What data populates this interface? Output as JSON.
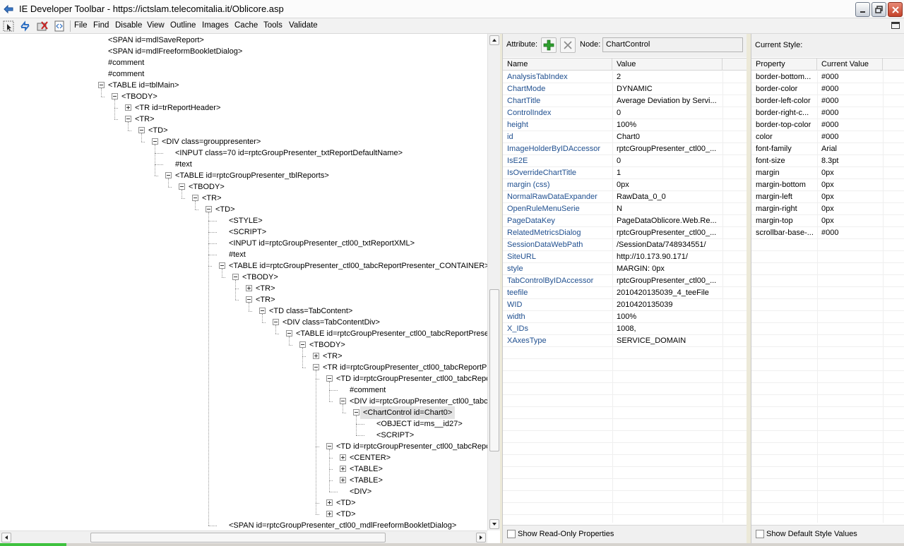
{
  "window": {
    "title": "IE Developer Toolbar - https://ictslam.telecomitalia.it/Oblicore.asp"
  },
  "menu": {
    "items": [
      "File",
      "Find",
      "Disable",
      "View",
      "Outline",
      "Images",
      "Cache",
      "Tools",
      "Validate"
    ]
  },
  "tree": {
    "nodes": [
      {
        "text": "<SPAN id=mdlSaveReport>",
        "depth": 0,
        "toggle": "none"
      },
      {
        "text": "<SPAN id=mdlFreeformBookletDialog>",
        "depth": 0,
        "toggle": "none"
      },
      {
        "text": "#comment",
        "depth": 0,
        "toggle": "none"
      },
      {
        "text": "#comment",
        "depth": 0,
        "toggle": "none"
      },
      {
        "text": "<TABLE id=tblMain>",
        "depth": 0,
        "toggle": "minus"
      },
      {
        "text": "<TBODY>",
        "depth": 1,
        "toggle": "minus"
      },
      {
        "text": "<TR id=trReportHeader>",
        "depth": 2,
        "toggle": "plus"
      },
      {
        "text": "<TR>",
        "depth": 2,
        "toggle": "minus"
      },
      {
        "text": "<TD>",
        "depth": 3,
        "toggle": "minus"
      },
      {
        "text": "<DIV class=grouppresenter>",
        "depth": 4,
        "toggle": "minus"
      },
      {
        "text": "<INPUT class=70 id=rptcGroupPresenter_txtReportDefaultName>",
        "depth": 5,
        "toggle": "none"
      },
      {
        "text": "#text",
        "depth": 5,
        "toggle": "none"
      },
      {
        "text": "<TABLE id=rptcGroupPresenter_tblReports>",
        "depth": 5,
        "toggle": "minus"
      },
      {
        "text": "<TBODY>",
        "depth": 6,
        "toggle": "minus"
      },
      {
        "text": "<TR>",
        "depth": 7,
        "toggle": "minus"
      },
      {
        "text": "<TD>",
        "depth": 8,
        "toggle": "minus"
      },
      {
        "text": "<STYLE>",
        "depth": 9,
        "toggle": "none"
      },
      {
        "text": "<SCRIPT>",
        "depth": 9,
        "toggle": "none"
      },
      {
        "text": "<INPUT id=rptcGroupPresenter_ctl00_txtReportXML>",
        "depth": 9,
        "toggle": "none"
      },
      {
        "text": "#text",
        "depth": 9,
        "toggle": "none"
      },
      {
        "text": "<TABLE id=rptcGroupPresenter_ctl00_tabcReportPresenter_CONTAINER>",
        "depth": 9,
        "toggle": "minus"
      },
      {
        "text": "<TBODY>",
        "depth": 10,
        "toggle": "minus"
      },
      {
        "text": "<TR>",
        "depth": 11,
        "toggle": "plus"
      },
      {
        "text": "<TR>",
        "depth": 11,
        "toggle": "minus"
      },
      {
        "text": "<TD class=TabContent>",
        "depth": 12,
        "toggle": "minus"
      },
      {
        "text": "<DIV class=TabContentDiv>",
        "depth": 13,
        "toggle": "minus"
      },
      {
        "text": "<TABLE id=rptcGroupPresenter_ctl00_tabcReportPresen",
        "depth": 14,
        "toggle": "minus"
      },
      {
        "text": "<TBODY>",
        "depth": 15,
        "toggle": "minus"
      },
      {
        "text": "<TR>",
        "depth": 16,
        "toggle": "plus"
      },
      {
        "text": "<TR id=rptcGroupPresenter_ctl00_tabcReportPr",
        "depth": 16,
        "toggle": "minus"
      },
      {
        "text": "<TD id=rptcGroupPresenter_ctl00_tabcRepc",
        "depth": 17,
        "toggle": "minus"
      },
      {
        "text": "#comment",
        "depth": 18,
        "toggle": "none"
      },
      {
        "text": "<DIV id=rptcGroupPresenter_ctl00_tabc",
        "depth": 18,
        "toggle": "minus"
      },
      {
        "text": "<ChartControl id=Chart0>",
        "depth": 19,
        "toggle": "minus",
        "selected": true
      },
      {
        "text": "<OBJECT id=ms__id27>",
        "depth": 20,
        "toggle": "none"
      },
      {
        "text": "<SCRIPT>",
        "depth": 20,
        "toggle": "none"
      },
      {
        "text": "<TD id=rptcGroupPresenter_ctl00_tabcRepc",
        "depth": 17,
        "toggle": "minus"
      },
      {
        "text": "<CENTER>",
        "depth": 18,
        "toggle": "plus"
      },
      {
        "text": "<TABLE>",
        "depth": 18,
        "toggle": "plus"
      },
      {
        "text": "<TABLE>",
        "depth": 18,
        "toggle": "plus"
      },
      {
        "text": "<DIV>",
        "depth": 18,
        "toggle": "none"
      },
      {
        "text": "<TD>",
        "depth": 17,
        "toggle": "plus"
      },
      {
        "text": "<TD>",
        "depth": 17,
        "toggle": "plus"
      },
      {
        "text": "<SPAN id=rptcGroupPresenter_ctl00_mdlFreeformBookletDialog>",
        "depth": 9,
        "toggle": "none"
      }
    ]
  },
  "attributes": {
    "label": "Attribute:",
    "node_label": "Node:",
    "node_value": "ChartControl",
    "col_name": "Name",
    "col_value": "Value",
    "rows": [
      {
        "name": "AnalysisTabIndex",
        "value": "2"
      },
      {
        "name": "ChartMode",
        "value": "DYNAMIC"
      },
      {
        "name": "ChartTitle",
        "value": "Average Deviation by Servi..."
      },
      {
        "name": "ControlIndex",
        "value": "0"
      },
      {
        "name": "height",
        "value": "100%"
      },
      {
        "name": "id",
        "value": "Chart0"
      },
      {
        "name": "ImageHolderByIDAccessor",
        "value": "rptcGroupPresenter_ctl00_..."
      },
      {
        "name": "IsE2E",
        "value": "0"
      },
      {
        "name": "IsOverrideChartTitle",
        "value": "1"
      },
      {
        "name": "margin (css)",
        "value": " 0px"
      },
      {
        "name": "NormalRawDataExpander",
        "value": "RawData_0_0"
      },
      {
        "name": "OpenRuleMenuSerie",
        "value": "N"
      },
      {
        "name": "PageDataKey",
        "value": "PageDataOblicore.Web.Re..."
      },
      {
        "name": "RelatedMetricsDialog",
        "value": "rptcGroupPresenter_ctl00_..."
      },
      {
        "name": "SessionDataWebPath",
        "value": "/SessionData/748934551/"
      },
      {
        "name": "SiteURL",
        "value": "http://10.173.90.171/"
      },
      {
        "name": "style",
        "value": "MARGIN: 0px"
      },
      {
        "name": "TabControlByIDAccessor",
        "value": "rptcGroupPresenter_ctl00_..."
      },
      {
        "name": "teefile",
        "value": "2010420135039_4_teeFile"
      },
      {
        "name": "WID",
        "value": "2010420135039"
      },
      {
        "name": "width",
        "value": "100%"
      },
      {
        "name": "X_IDs",
        "value": "1008,"
      },
      {
        "name": "XAxesType",
        "value": "SERVICE_DOMAIN"
      }
    ],
    "footer_checkbox": "Show Read-Only Properties"
  },
  "style": {
    "label": "Current Style:",
    "col_property": "Property",
    "col_value": "Current Value",
    "rows": [
      {
        "name": "border-bottom...",
        "value": "#000"
      },
      {
        "name": "border-color",
        "value": "#000"
      },
      {
        "name": "border-left-color",
        "value": "#000"
      },
      {
        "name": "border-right-c...",
        "value": "#000"
      },
      {
        "name": "border-top-color",
        "value": "#000"
      },
      {
        "name": "color",
        "value": "#000"
      },
      {
        "name": "font-family",
        "value": "Arial"
      },
      {
        "name": "font-size",
        "value": "8.3pt"
      },
      {
        "name": "margin",
        "value": "0px"
      },
      {
        "name": "margin-bottom",
        "value": "0px"
      },
      {
        "name": "margin-left",
        "value": "0px"
      },
      {
        "name": "margin-right",
        "value": "0px"
      },
      {
        "name": "margin-top",
        "value": "0px"
      },
      {
        "name": "scrollbar-base-...",
        "value": "#000"
      }
    ],
    "footer_checkbox": "Show Default Style Values"
  },
  "colors": {
    "attr_name": "#1f4f8f",
    "selected_bg": "#e3e3e3",
    "add_icon": "#2fa02f"
  }
}
